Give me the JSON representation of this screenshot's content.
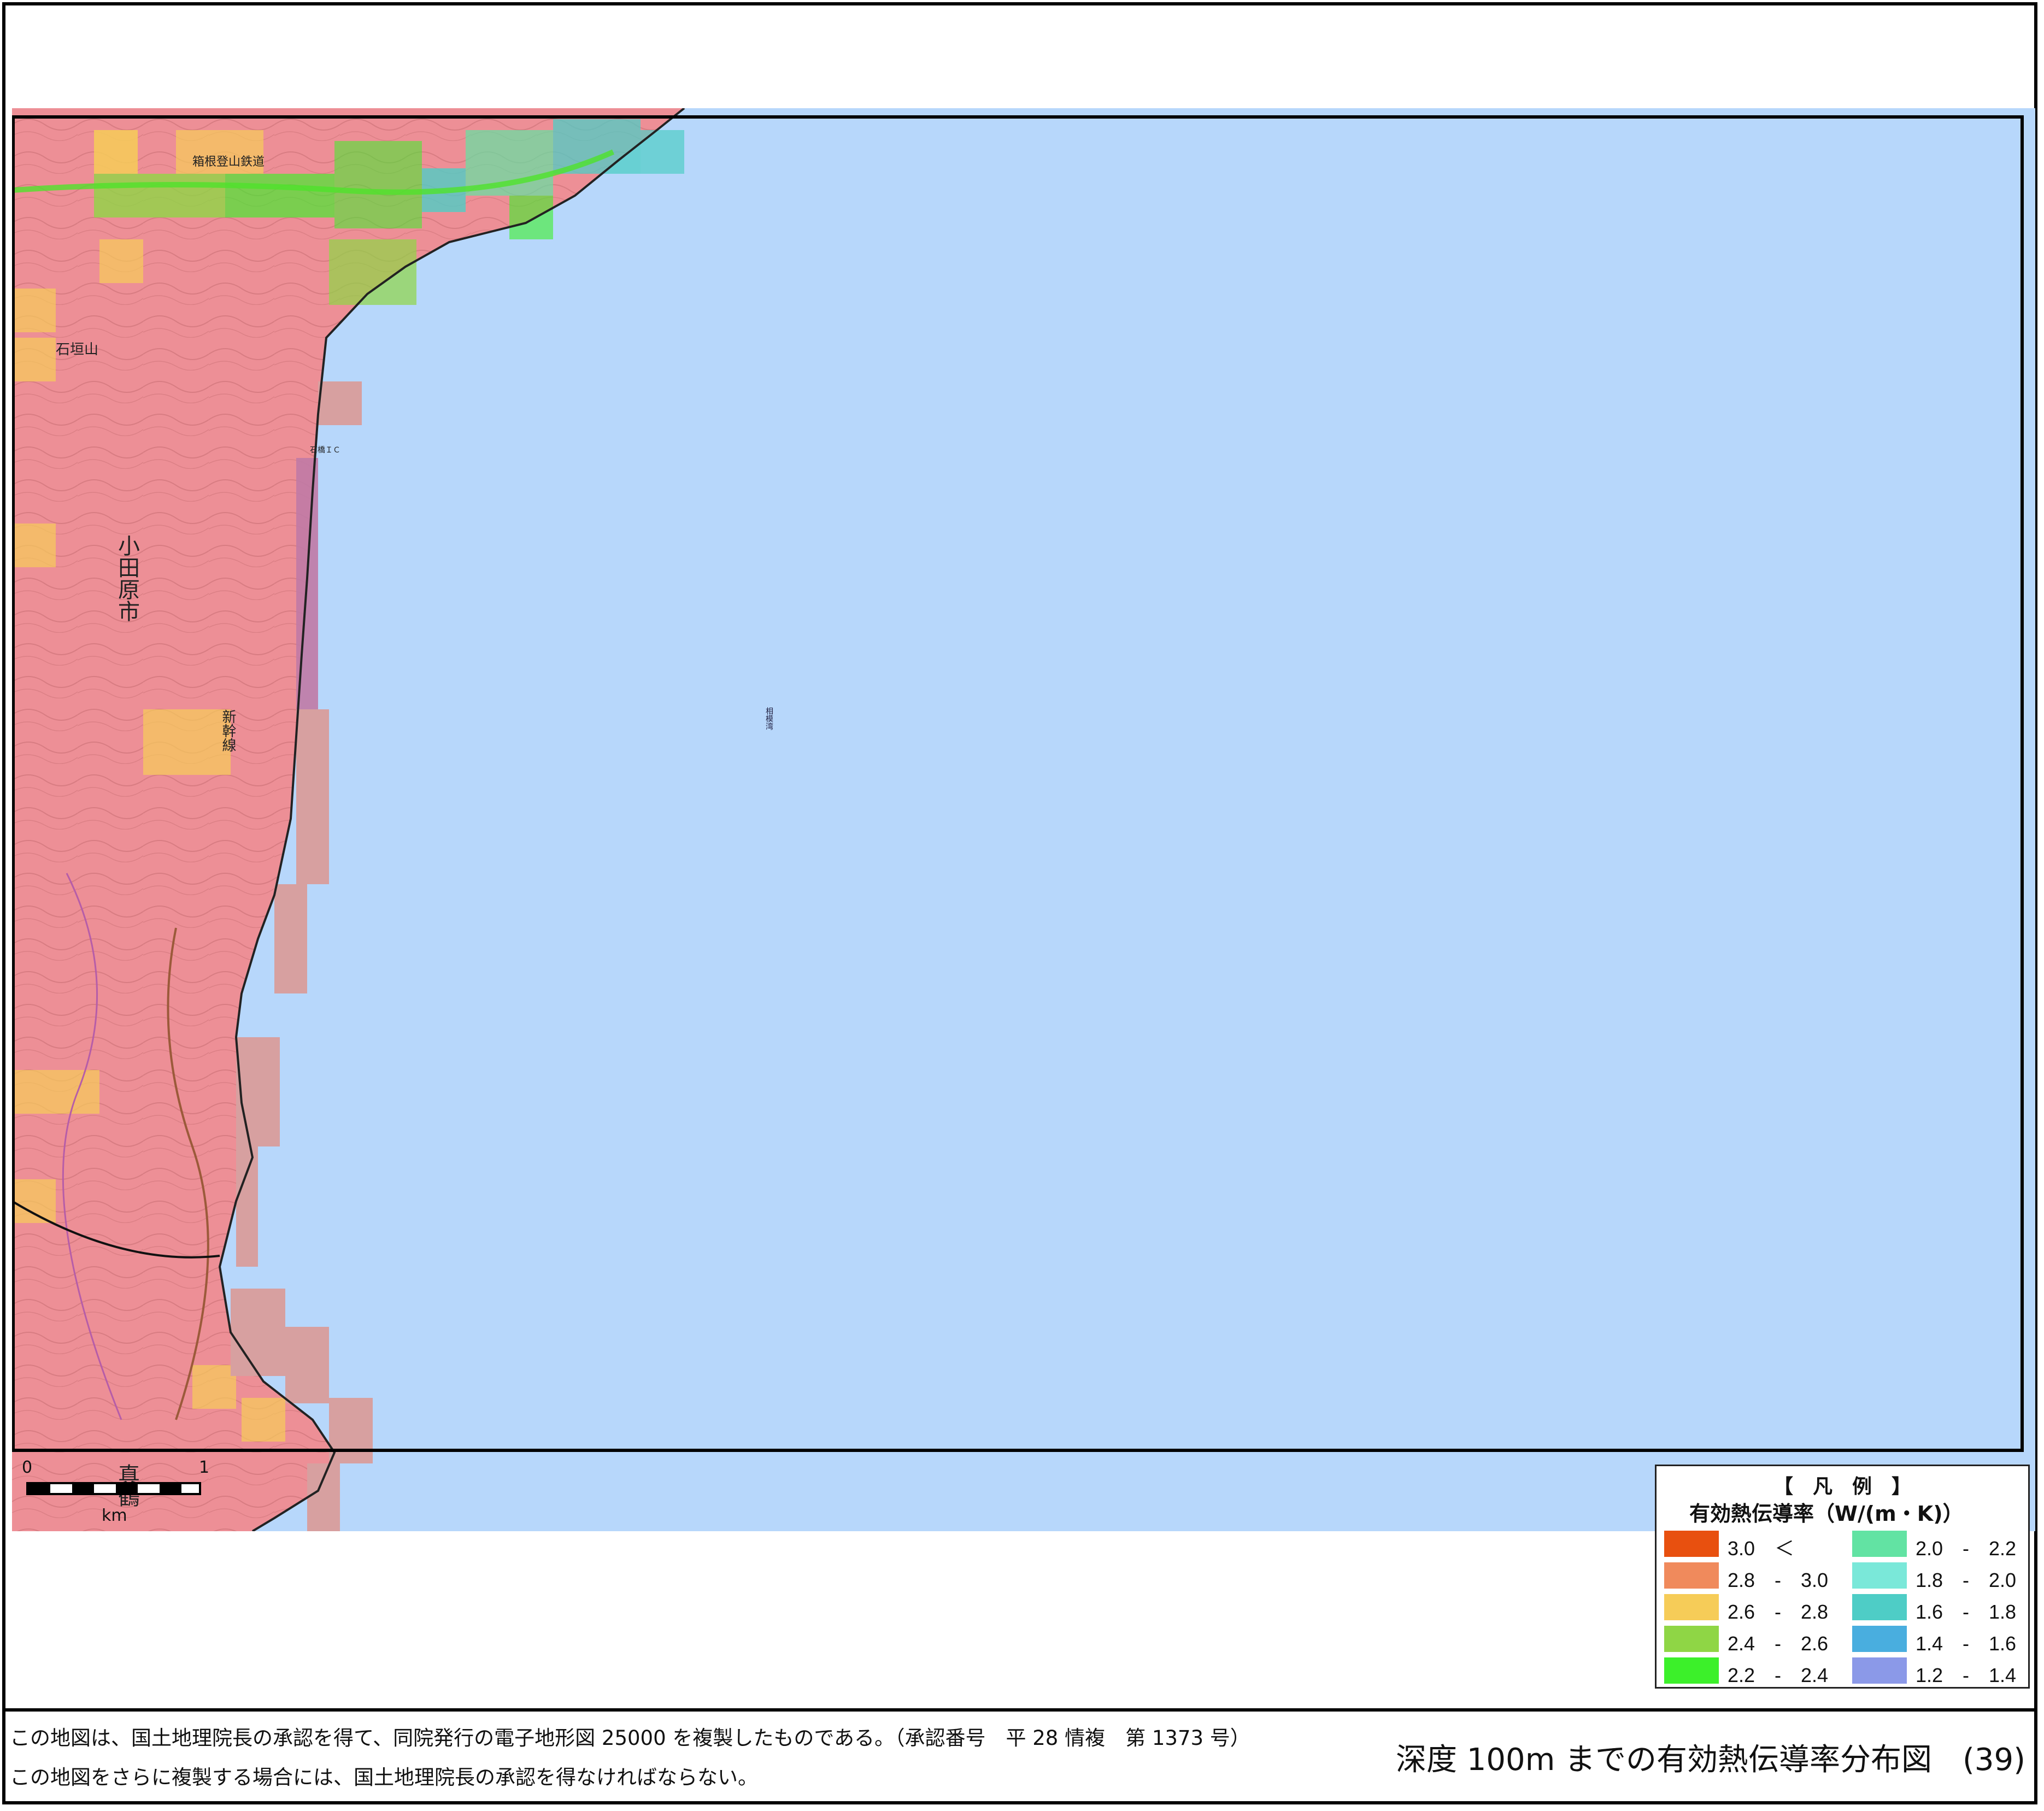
{
  "map": {
    "sea_color": "#b7d7fb",
    "land_color": "#ed8f96",
    "sea_label": "相模湾",
    "place_labels": {
      "city": "小田原市",
      "town": "真鶴",
      "mountain": "石垣山",
      "railway_line": "新幹線",
      "road": "箱根登山鉄道",
      "interchange": "石橋ＩＣ"
    }
  },
  "scale_bar": {
    "start_label": "0",
    "end_label": "1",
    "unit": "km"
  },
  "legend": {
    "title": "【　凡　例　】",
    "subtitle": "有効熱伝導率（W/(m・K)）",
    "items": [
      {
        "label": "3.0　＜",
        "color": "#e8500f"
      },
      {
        "label": "2.8　-　3.0",
        "color": "#f08a5c"
      },
      {
        "label": "2.6　-　2.8",
        "color": "#f6cc58"
      },
      {
        "label": "2.4　-　2.6",
        "color": "#8fd645"
      },
      {
        "label": "2.2　-　2.4",
        "color": "#3cf02a"
      },
      {
        "label": "2.0　-　2.2",
        "color": "#62e3a3"
      },
      {
        "label": "1.8　-　2.0",
        "color": "#7ae8d9"
      },
      {
        "label": "1.6　-　1.8",
        "color": "#4ecdc6"
      },
      {
        "label": "1.4　-　1.6",
        "color": "#49aedf"
      },
      {
        "label": "1.2　-　1.4",
        "color": "#8b99e8"
      }
    ]
  },
  "footer": {
    "notice_line1": "この地図は、国土地理院長の承認を得て、同院発行の電子地形図 25000 を複製したものである。（承認番号　平 28 情複　第 1373 号）",
    "notice_line2": "この地図をさらに複製する場合には、国土地理院長の承認を得なければならない。",
    "title": "深度 100m までの有効熱伝導率分布図　(39)"
  }
}
